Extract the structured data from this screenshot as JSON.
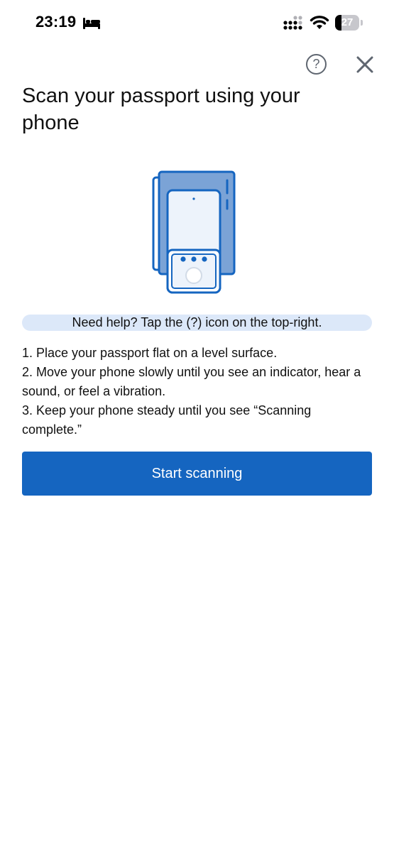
{
  "status_bar": {
    "time": "23:19",
    "battery_level": "27",
    "battery_fraction": 0.27,
    "icons": [
      "bed-icon",
      "cellular-signal-icon",
      "wifi-icon",
      "battery-icon"
    ]
  },
  "header": {
    "help_icon_glyph": "?",
    "icons": [
      "help-icon",
      "close-icon"
    ]
  },
  "title": "Scan your passport using your phone",
  "illustration": {
    "icon": "passport-phone-scan-icon"
  },
  "help_banner": "Need help? Tap the (?) icon on the top-right.",
  "instructions": [
    "1. Place your passport flat on a level surface.",
    "2. Move your phone slowly until you see an indicator, hear a sound, or feel a vibration.",
    "3. Keep your phone steady until you see “Scanning complete.”"
  ],
  "primary_button": {
    "label": "Start scanning"
  },
  "colors": {
    "accent": "#1565c0",
    "banner_background": "#dce8f9",
    "passport_fill": "#7ba3d6",
    "icon_gray": "#5f6670"
  }
}
